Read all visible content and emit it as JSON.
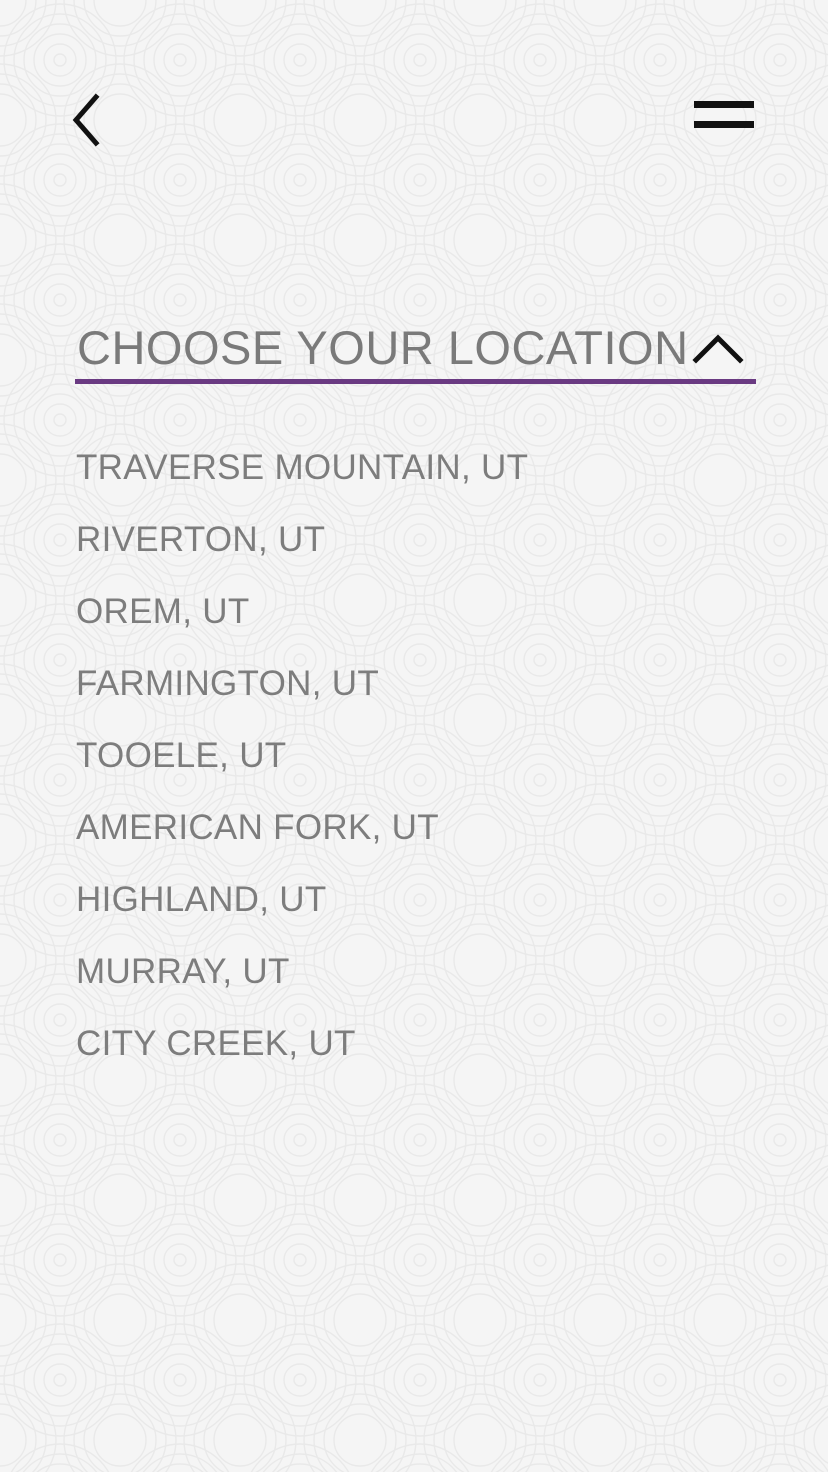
{
  "header": {
    "back_icon": "chevron-left-icon",
    "menu_icon": "hamburger-menu-icon"
  },
  "location_select": {
    "label": "CHOOSE YOUR LOCATION",
    "icon": "chevron-up-icon",
    "accent_color": "#6a3a82",
    "expanded": true
  },
  "locations": [
    "TRAVERSE MOUNTAIN, UT",
    "RIVERTON, UT",
    "OREM, UT",
    "FARMINGTON, UT",
    "TOOELE, UT",
    "AMERICAN FORK, UT",
    "HIGHLAND, UT",
    "MURRAY, UT",
    "CITY CREEK, UT"
  ]
}
